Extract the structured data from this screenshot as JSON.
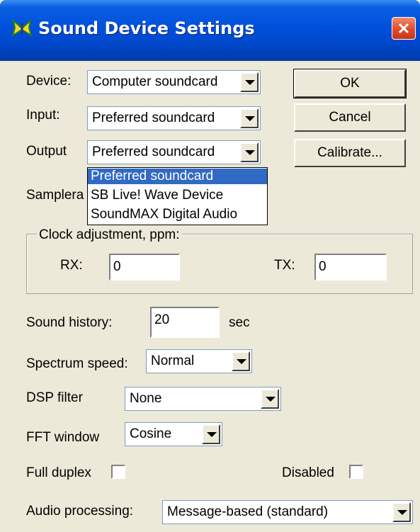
{
  "window": {
    "title": "Sound Device Settings",
    "icon": "butterfly-icon",
    "accent": "#0050dc"
  },
  "device": {
    "label": "Device:",
    "value": "Computer soundcard"
  },
  "input": {
    "label": "Input:",
    "value": "Preferred soundcard"
  },
  "output": {
    "label": "Output",
    "value": "Preferred soundcard",
    "options": [
      "Preferred soundcard",
      "SB Live! Wave Device",
      "SoundMAX Digital Audio"
    ],
    "highlighted_index": 0
  },
  "samplerate": {
    "label_visible": "Samplera"
  },
  "buttons": {
    "ok": "OK",
    "cancel": "Cancel",
    "calibrate": "Calibrate..."
  },
  "clock": {
    "title": "Clock adjustment, ppm:",
    "rx_label": "RX:",
    "rx_value": "0",
    "tx_label": "TX:",
    "tx_value": "0"
  },
  "sound_history": {
    "label": "Sound history:",
    "value": "20",
    "unit": "sec"
  },
  "spectrum_speed": {
    "label": "Spectrum speed:",
    "value": "Normal"
  },
  "dsp_filter": {
    "label": "DSP filter",
    "value": "None"
  },
  "fft_window": {
    "label": "FFT window",
    "value": "Cosine"
  },
  "full_duplex": {
    "label": "Full duplex",
    "checked": false
  },
  "disabled": {
    "label": "Disabled",
    "checked": false
  },
  "audio_processing": {
    "label": "Audio processing:",
    "value": "Message-based (standard)"
  }
}
